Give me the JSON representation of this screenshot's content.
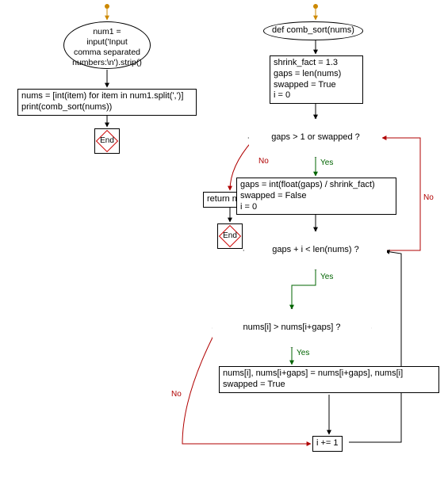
{
  "left": {
    "input_block": "num1 = input('Input\ncomma separated\nnumbers:\\n').strip()",
    "process_block": "nums = [int(item) for item in num1.split(',')]\nprint(comb_sort(nums))",
    "end_label": "End"
  },
  "right": {
    "def_block": "def comb_sort(nums)",
    "init_block": "shrink_fact = 1.3\ngaps = len(nums)\nswapped = True\ni = 0",
    "outer_cond": "gaps > 1 or swapped ?",
    "return_block": "return nums",
    "end_label": "End",
    "gap_update_block": "gaps = int(float(gaps) / shrink_fact)\nswapped = False\ni = 0",
    "inner_cond": "gaps + i < len(nums) ?",
    "compare_cond": "nums[i] > nums[i+gaps] ?",
    "swap_block": "nums[i], nums[i+gaps] = nums[i+gaps], nums[i]\nswapped = True",
    "increment_block": "i += 1"
  },
  "labels": {
    "yes": "Yes",
    "no": "No"
  }
}
